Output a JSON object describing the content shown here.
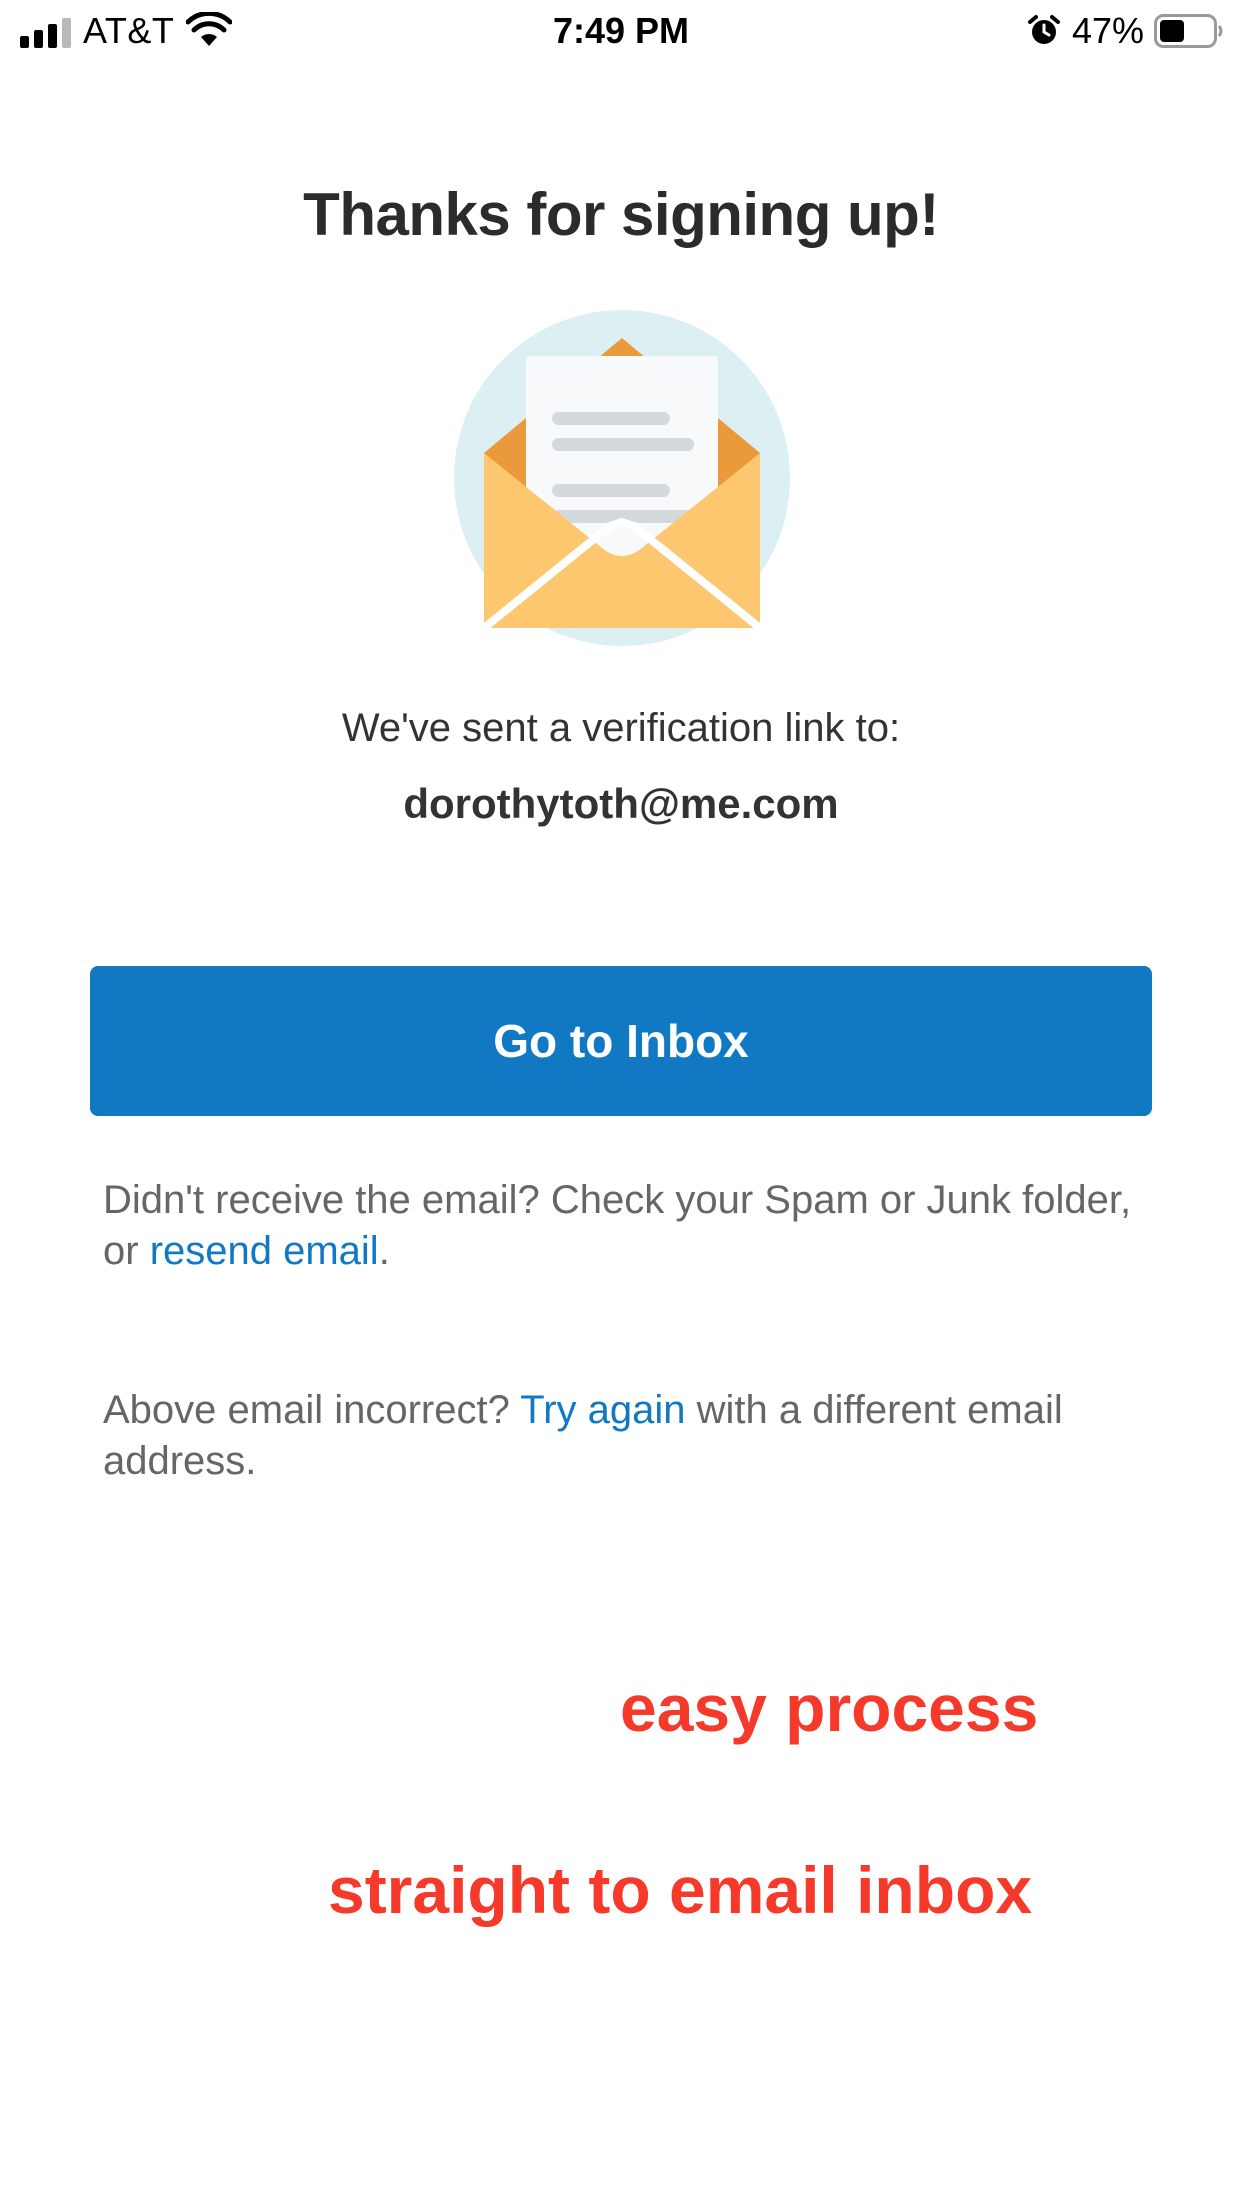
{
  "status_bar": {
    "carrier": "AT&T",
    "time": "7:49 PM",
    "battery_percent": "47%",
    "battery_level": 0.47,
    "icons": [
      "signal-icon",
      "wifi-icon",
      "alarm-icon",
      "battery-icon"
    ]
  },
  "page": {
    "title": "Thanks for signing up!",
    "illustration": "envelope-icon",
    "sent_line": "We've sent a verification link to:",
    "email": "dorothytoth@me.com",
    "button_label": "Go to Inbox"
  },
  "help": {
    "spam_text": "Didn't receive the email?  Check your Spam or Junk folder, or ",
    "resend_link": "resend email",
    "spam_suffix": ".",
    "retry_prefix": "Above email incorrect? ",
    "retry_link": "Try again",
    "retry_suffix": " with a different email address."
  },
  "annotations": {
    "note_1": "easy process",
    "note_2": "straight to email inbox"
  },
  "colors": {
    "primary": "#1178c4",
    "annotation": "#f53a2c",
    "envelope": "#fcc76f",
    "envelope_dark": "#ea9a3b",
    "circle": "#dcf0f3"
  }
}
